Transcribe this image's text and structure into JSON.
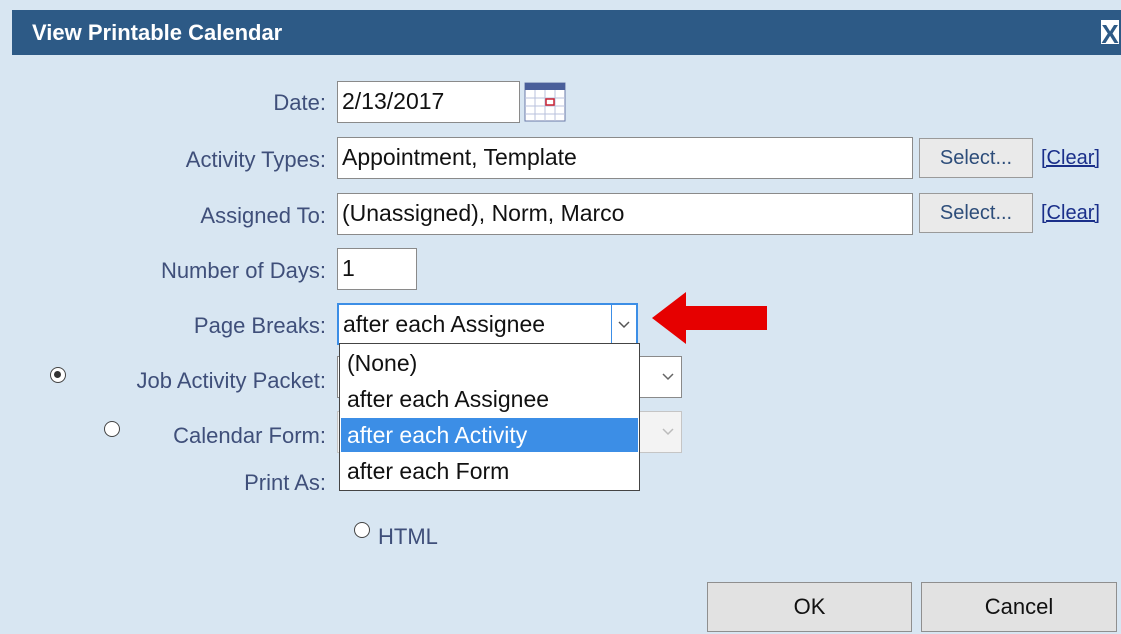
{
  "dialog": {
    "title": "View Printable Calendar",
    "close_symbol": "X"
  },
  "form": {
    "date_label": "Date:",
    "date_value": "2/13/2017",
    "activity_types_label": "Activity Types:",
    "activity_types_value": "Appointment, Template",
    "assigned_to_label": "Assigned To:",
    "assigned_to_value": "(Unassigned), Norm, Marco",
    "number_of_days_label": "Number of Days:",
    "number_of_days_value": "1",
    "page_breaks_label": "Page Breaks:",
    "page_breaks_selected": "after each Assignee",
    "job_activity_packet_label": "Job Activity Packet:",
    "calendar_form_label": "Calendar Form:",
    "print_as_label": "Print As:",
    "html_option_label": "HTML",
    "select_button_label": "Select...",
    "clear_link_label": "[Clear]"
  },
  "page_breaks_options": [
    "(None)",
    "after each Assignee",
    "after each Activity",
    "after each Form"
  ],
  "highlighted_option": "after each Activity",
  "buttons": {
    "ok": "OK",
    "cancel": "Cancel"
  },
  "colors": {
    "titlebar": "#2d5a86",
    "dialog_bg": "#d8e6f2",
    "highlight": "#3c8ee6",
    "annotation_arrow": "#e60000"
  },
  "icons": {
    "calendar": "calendar-icon",
    "close": "close-icon",
    "dropdown": "chevron-down-icon",
    "arrow": "red-arrow-icon"
  }
}
